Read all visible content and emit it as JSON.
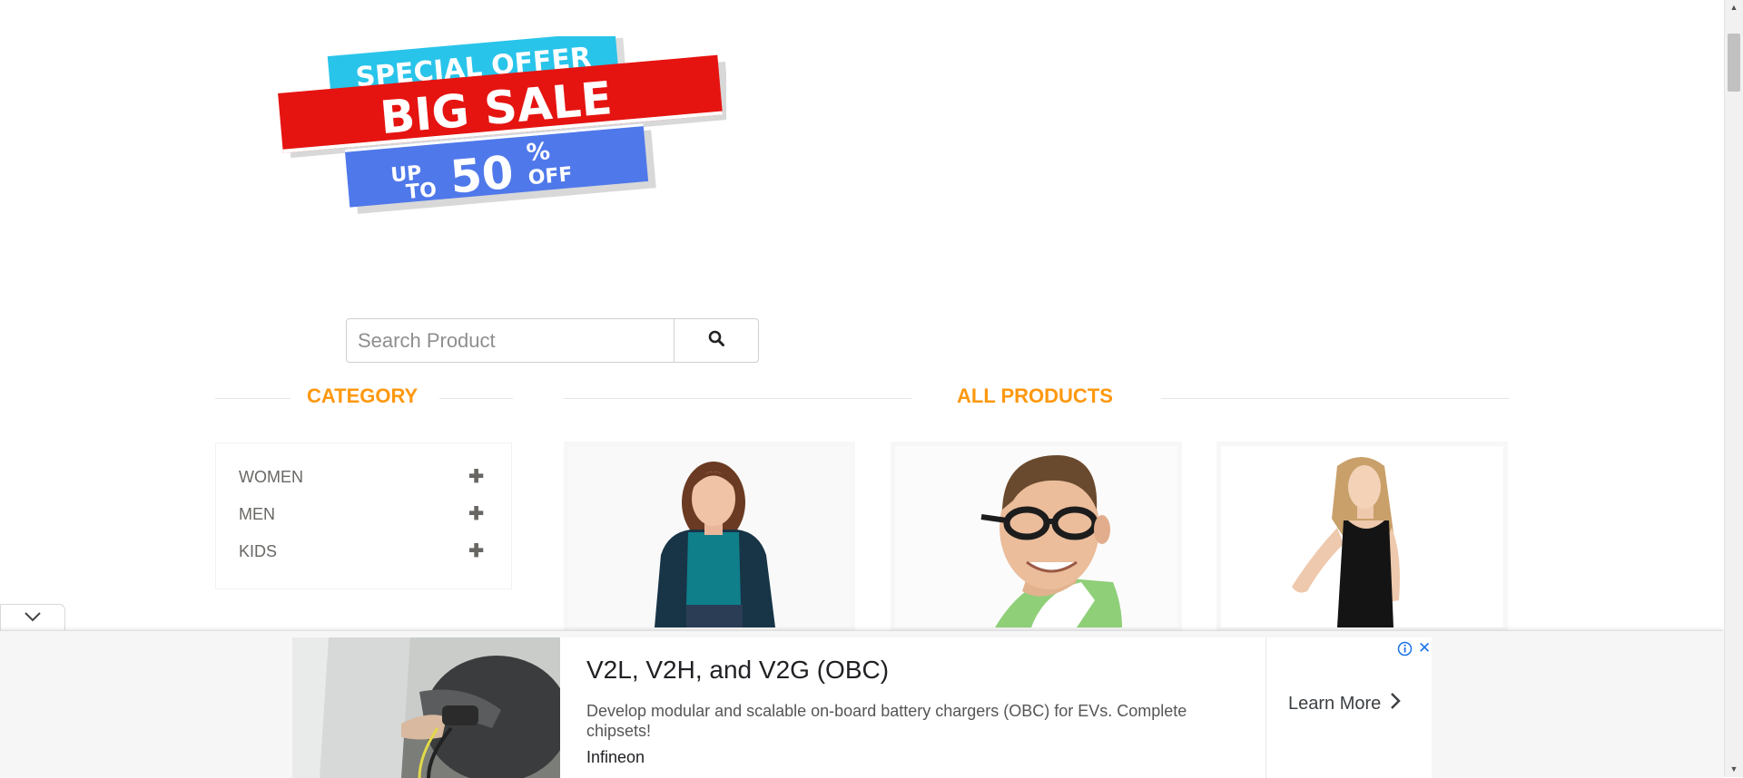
{
  "banner": {
    "line1": "SPECIAL OFFER",
    "line2": "BIG SALE",
    "up_to": "UP TO",
    "percent": "50",
    "percent_sign": "%",
    "off": "OFF",
    "colors": {
      "cyan": "#29c4ea",
      "red": "#e51411",
      "blue": "#4f78ea"
    }
  },
  "search": {
    "placeholder": "Search Product",
    "icon": "search-icon"
  },
  "sidebar": {
    "title": "CATEGORY",
    "categories": [
      {
        "label": "WOMEN",
        "icon": "plus-icon"
      },
      {
        "label": "MEN",
        "icon": "plus-icon"
      },
      {
        "label": "KIDS",
        "icon": "plus-icon"
      }
    ]
  },
  "products": {
    "title": "ALL PRODUCTS",
    "items": [
      {
        "image": "woman-in-teal-top"
      },
      {
        "image": "man-with-glasses"
      },
      {
        "image": "woman-in-black-dress"
      }
    ]
  },
  "ad": {
    "title": "V2L, V2H, and V2G (OBC)",
    "description": "Develop modular and scalable on-board battery chargers (OBC) for EVs. Complete chipsets!",
    "brand": "Infineon",
    "cta": "Learn More"
  },
  "colors": {
    "accent": "#fe980f",
    "link_blue": "#1a73e8"
  }
}
